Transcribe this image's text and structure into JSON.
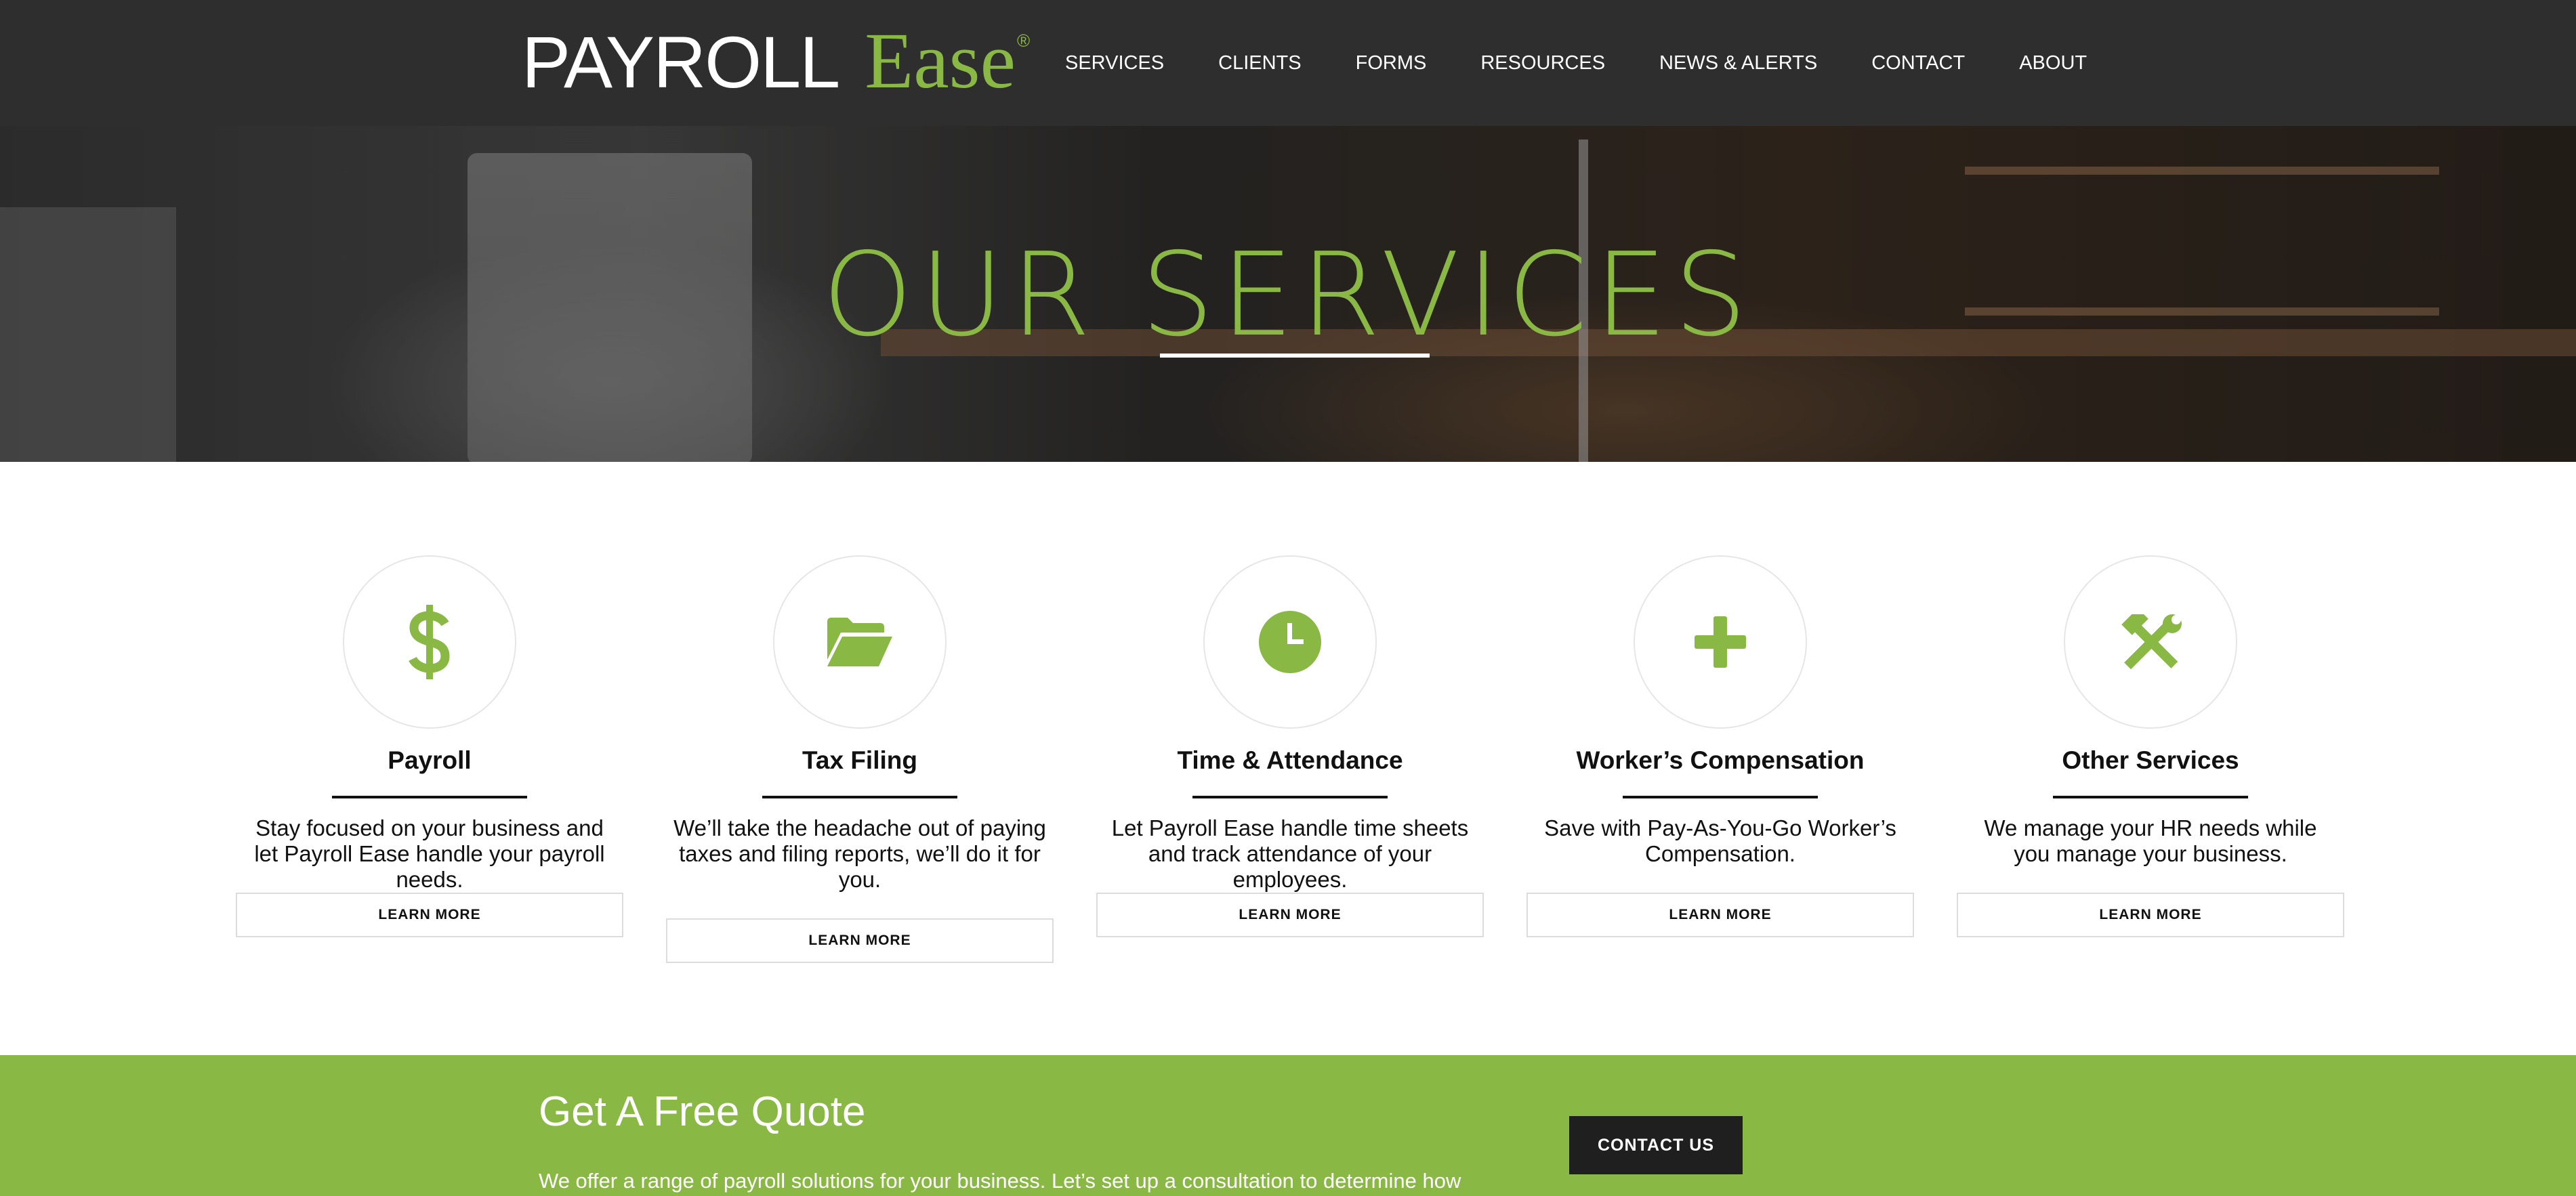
{
  "brand": {
    "name_part1": "PAYROLL",
    "name_part2": "Ease",
    "registered_mark": "®",
    "accent_color": "#8ab844",
    "header_bg": "#2e2e2e"
  },
  "nav": {
    "items": [
      {
        "label": "SERVICES"
      },
      {
        "label": "CLIENTS"
      },
      {
        "label": "FORMS"
      },
      {
        "label": "RESOURCES"
      },
      {
        "label": "NEWS & ALERTS"
      },
      {
        "label": "CONTACT"
      },
      {
        "label": "ABOUT"
      }
    ]
  },
  "hero": {
    "title": "OUR SERVICES"
  },
  "services": [
    {
      "icon": "dollar-icon",
      "title": "Payroll",
      "description": "Stay focused on your business and let Payroll Ease handle your payroll needs.",
      "button_label": "LEARN MORE"
    },
    {
      "icon": "folder-open-icon",
      "title": "Tax Filing",
      "description": "We’ll take the headache out of paying taxes and filing reports, we’ll do it for you.",
      "button_label": "LEARN MORE"
    },
    {
      "icon": "clock-icon",
      "title": "Time & Attendance",
      "description": "Let Payroll Ease handle time sheets and track attendance of your employees.",
      "button_label": "LEARN MORE"
    },
    {
      "icon": "plus-icon",
      "title": "Worker’s Compensation",
      "description": "Save with Pay-As-You-Go Worker’s Compensation.",
      "button_label": "LEARN MORE"
    },
    {
      "icon": "tools-icon",
      "title": "Other Services",
      "description": "We manage your HR needs while you manage your business.",
      "button_label": "LEARN MORE"
    }
  ],
  "quote": {
    "title": "Get A Free Quote",
    "text": "We offer a range of payroll solutions for your business. Let’s set up a consultation to determine how",
    "button_label": "CONTACT US"
  }
}
